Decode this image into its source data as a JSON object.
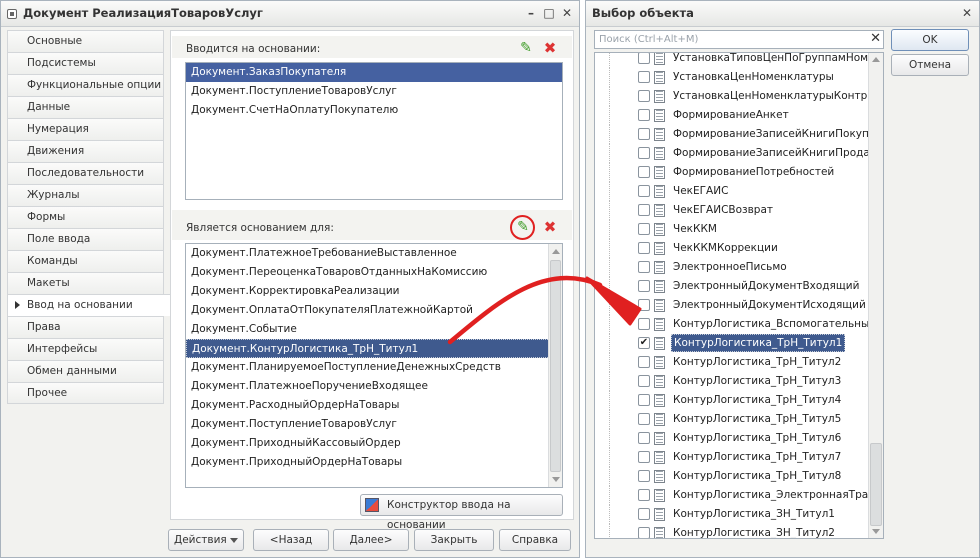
{
  "left_window": {
    "title": "Документ РеализацияТоваровУслуг",
    "tabs": [
      "Основные",
      "Подсистемы",
      "Функциональные опции",
      "Данные",
      "Нумерация",
      "Движения",
      "Последовательности",
      "Журналы",
      "Формы",
      "Поле ввода",
      "Команды",
      "Макеты",
      "Ввод на основании",
      "Права",
      "Интерфейсы",
      "Обмен данными",
      "Прочее"
    ],
    "active_tab": "Ввод на основании",
    "entered_on_basis": {
      "label": "Вводится на основании:",
      "items": [
        "Документ.ЗаказПокупателя",
        "Документ.ПоступлениеТоваровУслуг",
        "Документ.СчетНаОплатуПокупателю"
      ]
    },
    "is_basis_for": {
      "label": "Является основанием для:",
      "items": [
        "Документ.ПлатежноеТребованиеВыставленное",
        "Документ.ПереоценкаТоваровОтданныхНаКомиссию",
        "Документ.КорректировкаРеализации",
        "Документ.ОплатаОтПокупателяПлатежнойКартой",
        "Документ.Событие",
        "Документ.КонтурЛогистика_ТрН_Титул1",
        "Документ.ПланируемоеПоступлениеДенежныхСредств",
        "Документ.ПлатежноеПоручениеВходящее",
        "Документ.РасходныйОрдерНаТовары",
        "Документ.ПоступлениеТоваровУслуг",
        "Документ.ПриходныйКассовыйОрдер",
        "Документ.ПриходныйОрдерНаТовары"
      ]
    },
    "constructor_button": "Конструктор ввода на основании",
    "buttons": {
      "actions": "Действия",
      "back": "<Назад",
      "next": "Далее>",
      "close": "Закрыть",
      "help": "Справка"
    }
  },
  "right_window": {
    "title": "Выбор объекта",
    "search_placeholder": "Поиск (Ctrl+Alt+M)",
    "ok": "OK",
    "cancel": "Отмена",
    "items": [
      {
        "label": "УстановкаТиповЦенПоГруппамНоменклатуры",
        "checked": false
      },
      {
        "label": "УстановкаЦенНоменклатуры",
        "checked": false
      },
      {
        "label": "УстановкаЦенНоменклатурыКонтрагентов",
        "checked": false
      },
      {
        "label": "ФормированиеАнкет",
        "checked": false
      },
      {
        "label": "ФормированиеЗаписейКнигиПокупок",
        "checked": false
      },
      {
        "label": "ФормированиеЗаписейКнигиПродаж",
        "checked": false
      },
      {
        "label": "ФормированиеПотребностей",
        "checked": false
      },
      {
        "label": "ЧекЕГАИС",
        "checked": false
      },
      {
        "label": "ЧекЕГАИСВозврат",
        "checked": false
      },
      {
        "label": "ЧекККМ",
        "checked": false
      },
      {
        "label": "ЧекККМКоррекции",
        "checked": false
      },
      {
        "label": "ЭлектронноеПисьмо",
        "checked": false
      },
      {
        "label": "ЭлектронныйДокументВходящий",
        "checked": false
      },
      {
        "label": "ЭлектронныйДокументИсходящий",
        "checked": false
      },
      {
        "label": "КонтурЛогистика_Вспомогательный",
        "checked": false
      },
      {
        "label": "КонтурЛогистика_ТрН_Титул1",
        "checked": true
      },
      {
        "label": "КонтурЛогистика_ТрН_Титул2",
        "checked": false
      },
      {
        "label": "КонтурЛогистика_ТрН_Титул3",
        "checked": false
      },
      {
        "label": "КонтурЛогистика_ТрН_Титул4",
        "checked": false
      },
      {
        "label": "КонтурЛогистика_ТрН_Титул5",
        "checked": false
      },
      {
        "label": "КонтурЛогистика_ТрН_Титул6",
        "checked": false
      },
      {
        "label": "КонтурЛогистика_ТрН_Титул7",
        "checked": false
      },
      {
        "label": "КонтурЛогистика_ТрН_Титул8",
        "checked": false
      },
      {
        "label": "КонтурЛогистика_ЭлектроннаяТранспортнаяНакладная",
        "checked": false
      },
      {
        "label": "КонтурЛогистика_ЗН_Титул1",
        "checked": false
      },
      {
        "label": "КонтурЛогистика_ЗН_Титул2",
        "checked": false
      }
    ]
  },
  "colors": {
    "selection": "#3f5a8e",
    "arrow": "#e02020",
    "pencil": "#3c9b25",
    "delete": "#d33333"
  }
}
